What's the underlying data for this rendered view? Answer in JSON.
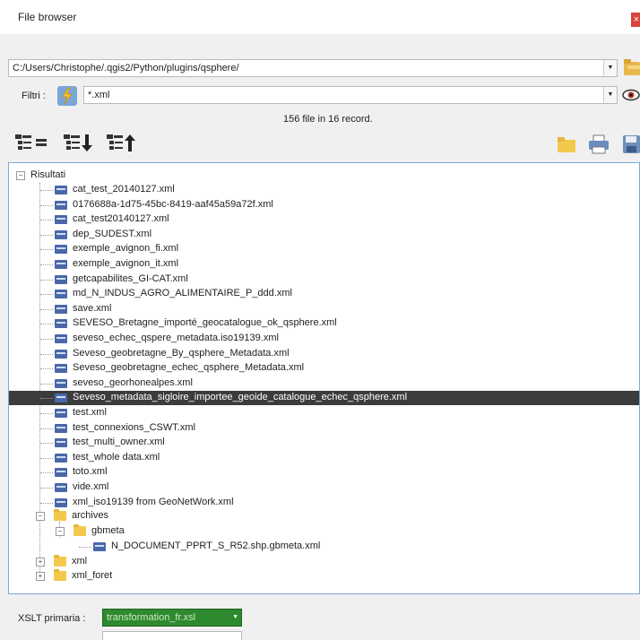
{
  "window": {
    "title": "File browser",
    "close_label": "×"
  },
  "path": {
    "value": "C:/Users/Christophe/.qgis2/Python/plugins/qsphere/"
  },
  "filter": {
    "label": "Filtri :",
    "value": "*.xml"
  },
  "status": {
    "text": "156 file in 16 record."
  },
  "tree": {
    "root_label": "Risultati",
    "files": [
      "cat_test_20140127.xml",
      "0176688a-1d75-45bc-8419-aaf45a59a72f.xml",
      "cat_test20140127.xml",
      "dep_SUDEST.xml",
      "exemple_avignon_fi.xml",
      "exemple_avignon_it.xml",
      "getcapabilites_GI-CAT.xml",
      "md_N_INDUS_AGRO_ALIMENTAIRE_P_ddd.xml",
      "save.xml",
      "SEVESO_Bretagne_importé_geocatalogue_ok_qsphere.xml",
      "seveso_echec_qspere_metadata.iso19139.xml",
      "Seveso_geobretagne_By_qsphere_Metadata.xml",
      "Seveso_geobretagne_echec_qsphere_Metadata.xml",
      "seveso_georhonealpes.xml",
      "Seveso_metadata_sigloire_importee_geoide_catalogue_echec_qsphere.xml",
      "test.xml",
      "test_connexions_CSWT.xml",
      "test_multi_owner.xml",
      "test_whole data.xml",
      "toto.xml",
      "vide.xml",
      "xml_iso19139 from GeoNetWork.xml"
    ],
    "selected_index": 14,
    "archives_label": "archives",
    "gbmeta_label": "gbmeta",
    "gbmeta_file": "N_DOCUMENT_PPRT_S_R52.shp.gbmeta.xml",
    "xml_folder": "xml",
    "xml_foret_folder": "xml_foret"
  },
  "xslt": {
    "label": "XSLT primaria :",
    "value": "transformation_fr.xsl"
  },
  "colors": {
    "selection": "#3c3c3c",
    "xslt_bg": "#2e8a2e",
    "tree_border": "#7fa7d6"
  },
  "icons": [
    "tree-collapse-icon",
    "tree-sort-down-icon",
    "tree-sort-up-icon",
    "folder-icon",
    "print-icon",
    "save-icon",
    "lightning-icon",
    "eye-icon",
    "folder-browse-icon"
  ]
}
